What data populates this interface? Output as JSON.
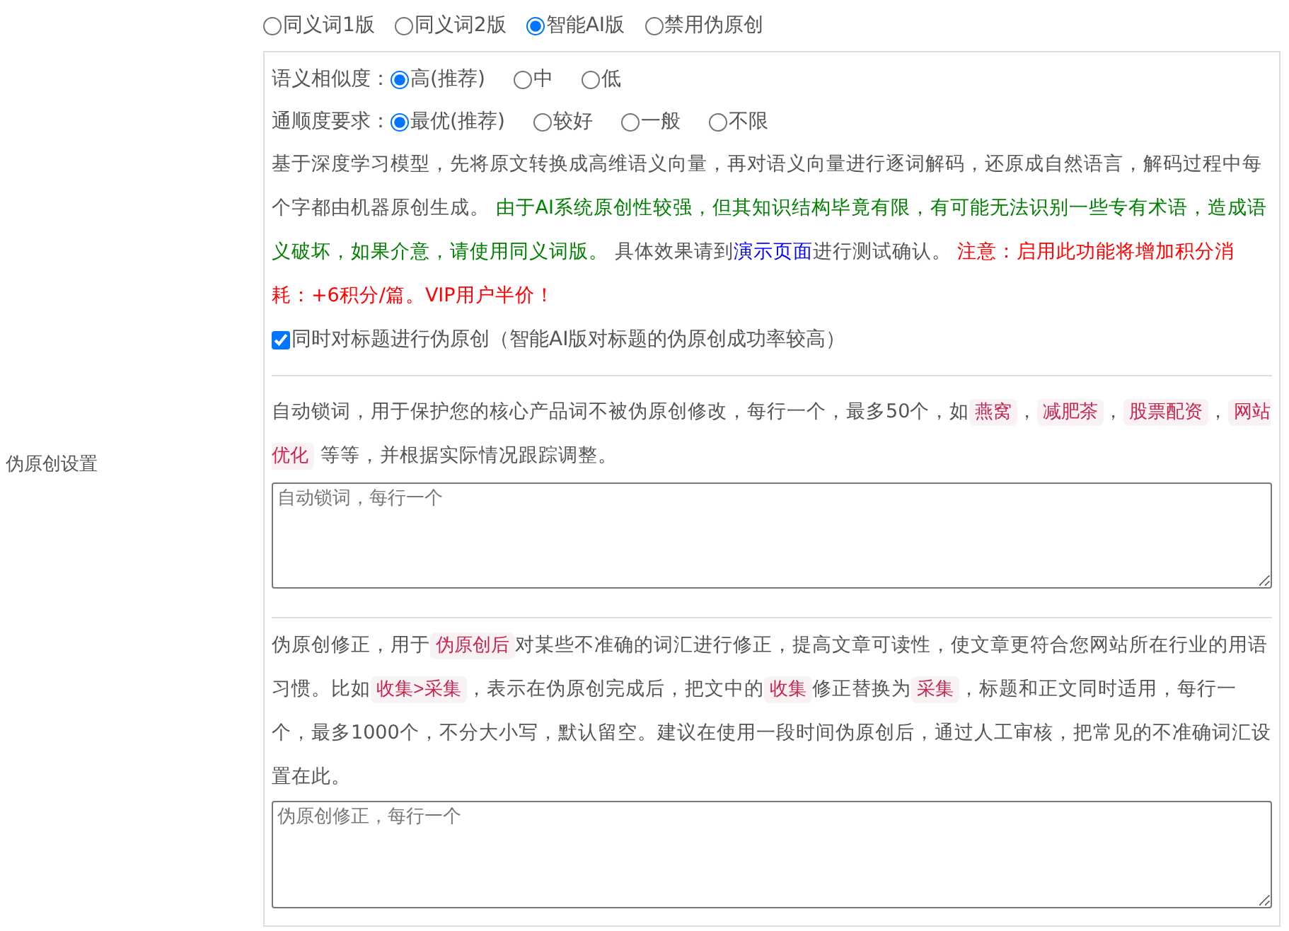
{
  "side_label": "伪原创设置",
  "mode_options": [
    {
      "label": "同义词1版",
      "selected": false
    },
    {
      "label": "同义词2版",
      "selected": false
    },
    {
      "label": "智能AI版",
      "selected": true
    },
    {
      "label": "禁用伪原创",
      "selected": false
    }
  ],
  "similarity": {
    "label": "语义相似度：",
    "options": [
      {
        "label": "高(推荐)",
        "selected": true
      },
      {
        "label": "中",
        "selected": false
      },
      {
        "label": "低",
        "selected": false
      }
    ]
  },
  "fluency": {
    "label": "通顺度要求：",
    "options": [
      {
        "label": "最优(推荐)",
        "selected": true
      },
      {
        "label": "较好",
        "selected": false
      },
      {
        "label": "一般",
        "selected": false
      },
      {
        "label": "不限",
        "selected": false
      }
    ]
  },
  "ai_description": [
    {
      "kind": "text",
      "text": "基于深度学习模型，先将原文转换成高维语义向量，再对语义向量进行逐词解码，还原成自然语言，解码过程中每个字都由机器原创生成。 "
    },
    {
      "kind": "caution",
      "text": "由于AI系统原创性较强，但其知识结构毕竟有限，有可能无法识别一些专有术语，造成语义破坏，如果介意，请使用同义词版。"
    },
    {
      "kind": "text",
      "text": " 具体效果请到"
    },
    {
      "kind": "link",
      "text": "演示页面"
    },
    {
      "kind": "text",
      "text": "进行测试确认。 "
    },
    {
      "kind": "warning",
      "text": "注意：启用此功能将增加积分消耗：+6积分/篇。VIP用户半价！"
    }
  ],
  "title_option": {
    "label": "同时对标题进行伪原创（智能AI版对标题的伪原创成功率较高）",
    "checked": true
  },
  "lock_words": {
    "description": [
      {
        "kind": "text",
        "text": "自动锁词，用于保护您的核心产品词不被伪原创修改，每行一个，最多50个，如"
      },
      {
        "kind": "tag",
        "text": "燕窝"
      },
      {
        "kind": "text",
        "text": "，"
      },
      {
        "kind": "tag",
        "text": "减肥茶"
      },
      {
        "kind": "text",
        "text": "，"
      },
      {
        "kind": "tag",
        "text": "股票配资"
      },
      {
        "kind": "text",
        "text": "，"
      },
      {
        "kind": "tag",
        "text": "网站优化"
      },
      {
        "kind": "text",
        "text": " 等等，并根据实际情况跟踪调整。"
      }
    ],
    "placeholder": "自动锁词，每行一个"
  },
  "corrections": {
    "description": [
      {
        "kind": "text",
        "text": "伪原创修正，用于"
      },
      {
        "kind": "tag",
        "text": "伪原创后"
      },
      {
        "kind": "text",
        "text": "对某些不准确的词汇进行修正，提高文章可读性，使文章更符合您网站所在行业的用语习惯。比如"
      },
      {
        "kind": "tag",
        "text": "收集>采集"
      },
      {
        "kind": "text",
        "text": "，表示在伪原创完成后，把文中的"
      },
      {
        "kind": "tag",
        "text": "收集"
      },
      {
        "kind": "text",
        "text": "修正替换为"
      },
      {
        "kind": "tag",
        "text": "采集"
      },
      {
        "kind": "text",
        "text": "，标题和正文同时适用，每行一个，最多1000个，不分大小写，默认留空。建议在使用一段时间伪原创后，通过人工审核，把常见的不准确词汇设置在此。"
      }
    ],
    "placeholder": "伪原创修正，每行一个"
  }
}
